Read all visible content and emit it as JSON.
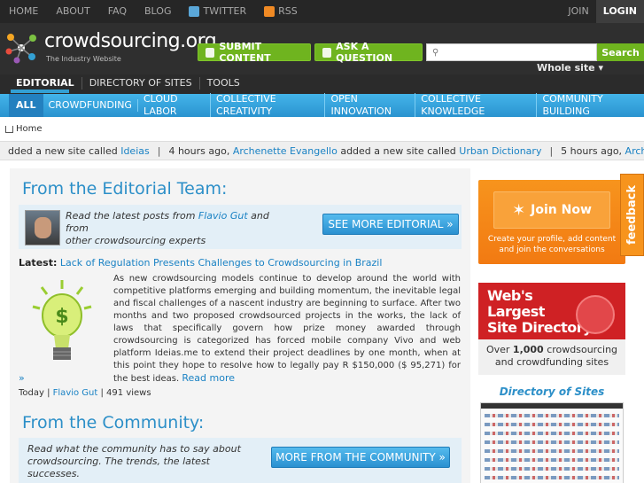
{
  "topnav": {
    "items": [
      "HOME",
      "ABOUT",
      "FAQ",
      "BLOG"
    ],
    "twitter": "TWITTER",
    "rss": "RSS",
    "join": "JOIN",
    "login": "LOGIN"
  },
  "header": {
    "logo": "crowdsourcing.org",
    "tagline": "The Industry Website",
    "submit": "SUBMIT CONTENT",
    "ask": "ASK A QUESTION",
    "search_button": "Search",
    "search_scope": "Whole site ▾"
  },
  "section_nav": [
    "EDITORIAL",
    "DIRECTORY OF SITES",
    "TOOLS"
  ],
  "categories": [
    "ALL",
    "CROWDFUNDING",
    "CLOUD LABOR",
    "COLLECTIVE CREATIVITY",
    "OPEN INNOVATION",
    "COLLECTIVE KNOWLEDGE",
    "COMMUNITY BUILDING"
  ],
  "breadcrumb": "Home",
  "ticker": {
    "t1": "dded a new site called ",
    "l1": "Ideias",
    "t2": "4 hours ago, ",
    "l2": "Archenette Evangello",
    "t3": " added a new site called ",
    "l3": "Urban Dictionary",
    "t4": "5 hours ago, ",
    "l4": "Archenette"
  },
  "editorial": {
    "title": "From the Editorial Team:",
    "intro_a": "Read the latest posts from ",
    "intro_author": "Flavio Gut",
    "intro_b": " and from",
    "intro_c": "other crowdsourcing experts",
    "button": "SEE MORE EDITORIAL »",
    "latest_label": "Latest:",
    "latest_title": "Lack of Regulation Presents Challenges to Crowdsourcing in Brazil",
    "article": "As new crowdsourcing models continue to develop around the world with competitive platforms emerging and building momentum,  the inevitable legal and fiscal challenges of a nascent industry are beginning to surface. After two months and two proposed crowdsourced projects in the works, the lack of laws that specifically govern how prize money awarded through crowdsourcing is categorized has forced mobile company Vivo and web platform Ideias.me to extend their project deadlines by one month, when at this point they hope to resolve how to legally pay R $150,000 ($ 95,271) for the best ideas. ",
    "read_more": "Read more",
    "read_more_tail": "»",
    "meta_date": "Today | ",
    "meta_author": "Flavio Gut",
    "meta_views": " | 491 views"
  },
  "community": {
    "title": "From the Community:",
    "intro": "Read what the community has to say about crowdsourcing. The trends, the latest successes.",
    "button": "MORE FROM THE COMMUNITY »"
  },
  "sidebar": {
    "join_button": "Join Now",
    "join_sub": "Create your profile, add content and join the conversations",
    "feedback": "feedback",
    "dir_title_1": "Web's",
    "dir_title_2": "Largest",
    "dir_title_3": "Site Directory",
    "dir_over": "Over ",
    "dir_count": "1,000",
    "dir_rest": " crowdsourcing",
    "dir_line2": "and crowdfunding sites",
    "dir_caption": "Directory of Sites"
  }
}
